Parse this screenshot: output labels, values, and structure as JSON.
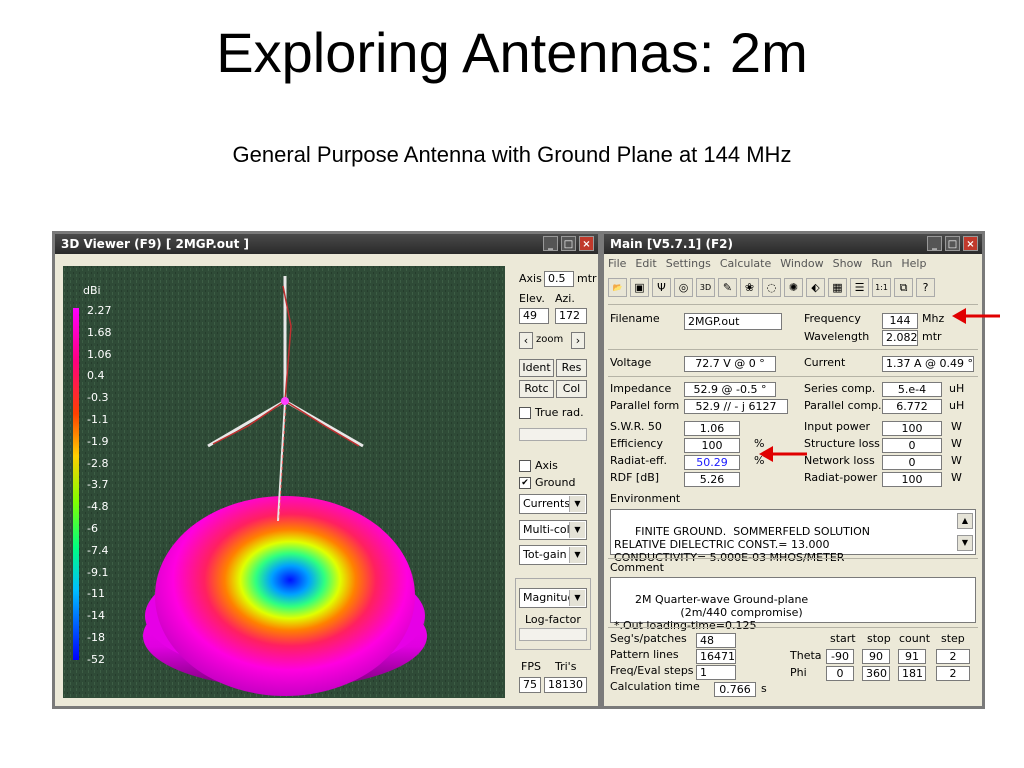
{
  "slide": {
    "title": "Exploring Antennas: 2m",
    "subtitle": "General Purpose Antenna with Ground Plane at 144 MHz"
  },
  "viewer": {
    "title": "3D Viewer (F9)    [ 2MGP.out ]",
    "legend_unit": "dBi",
    "legend": [
      "2.27",
      "1.68",
      "1.06",
      "0.4",
      "-0.3",
      "-1.1",
      "-1.9",
      "-2.8",
      "-3.7",
      "-4.8",
      "-6",
      "-7.4",
      "-9.1",
      "-11",
      "-14",
      "-18",
      "-52"
    ],
    "axis_label": "Axis",
    "axis_value": "0.5",
    "axis_unit": "mtr",
    "elev_label": "Elev.",
    "azi_label": "Azi.",
    "elev_value": "49",
    "azi_value": "172",
    "zoom_label": "zoom",
    "ident_label": "Ident",
    "res_label": "Res",
    "rotc_label": "Rotc",
    "col_label": "Col",
    "true_rad_label": "True rad.",
    "true_rad_checked": false,
    "axis_check_label": "Axis",
    "axis_checked": false,
    "ground_label": "Ground",
    "ground_checked": true,
    "currents_select": "Currents",
    "multicolor_select": "Multi-colo",
    "totgain_select": "Tot-gain",
    "magnitude_select": "Magnituc",
    "logfactor_label": "Log-factor",
    "fps_label": "FPS",
    "tris_label": "Tri's",
    "fps_value": "75",
    "tris_value": "18130"
  },
  "main": {
    "title": "Main [V5.7.1]  (F2)",
    "menu": [
      "File",
      "Edit",
      "Settings",
      "Calculate",
      "Window",
      "Show",
      "Run",
      "Help"
    ],
    "toolbar_icons": [
      "open-icon",
      "save-icon",
      "antenna-icon",
      "target-icon",
      "3d-icon",
      "edit-icon",
      "pattern-icon",
      "rings-icon",
      "radiation-icon",
      "select-icon",
      "calculator-icon",
      "list-icon",
      "ratio-icon",
      "book-icon",
      "help-icon"
    ],
    "filename_label": "Filename",
    "filename": "2MGP.out",
    "frequency_label": "Frequency",
    "frequency": "144",
    "frequency_unit": "Mhz",
    "wavelength_label": "Wavelength",
    "wavelength": "2.082",
    "wavelength_unit": "mtr",
    "voltage_label": "Voltage",
    "voltage": "72.7 V @ 0 °",
    "current_label": "Current",
    "current": "1.37 A @ 0.49 °",
    "impedance_label": "Impedance",
    "impedance": "52.9 @ -0.5 °",
    "series_comp_label": "Series comp.",
    "series_comp": "5.e-4",
    "series_comp_unit": "uH",
    "parallel_form_label": "Parallel form",
    "parallel_form": "52.9 // - j 6127",
    "parallel_comp_label": "Parallel comp.",
    "parallel_comp": "6.772",
    "parallel_comp_unit": "uH",
    "swr_label": "S.W.R. 50",
    "swr": "1.06",
    "input_power_label": "Input power",
    "input_power": "100",
    "input_power_unit": "W",
    "efficiency_label": "Efficiency",
    "efficiency": "100",
    "efficiency_unit": "%",
    "structure_loss_label": "Structure loss",
    "structure_loss": "0",
    "structure_loss_unit": "W",
    "radiat_eff_label": "Radiat-eff.",
    "radiat_eff": "50.29",
    "radiat_eff_unit": "%",
    "network_loss_label": "Network loss",
    "network_loss": "0",
    "network_loss_unit": "W",
    "rdf_label": "RDF [dB]",
    "rdf": "5.26",
    "radiat_power_label": "Radiat-power",
    "radiat_power": "100",
    "radiat_power_unit": "W",
    "environment_label": "Environment",
    "environment": "FINITE GROUND.  SOMMERFELD SOLUTION\nRELATIVE DIELECTRIC CONST.= 13.000\nCONDUCTIVITY= 5.000E-03 MHOS/METER",
    "comment_label": "Comment",
    "comment": "2M Quarter-wave Ground-plane\n                   (2m/440 compromise)\n*.Out loading-time=0.125",
    "segs_label": "Seg's/patches",
    "segs": "48",
    "pattern_lines_label": "Pattern lines",
    "pattern_lines": "16471",
    "freq_eval_label": "Freq/Eval steps",
    "freq_eval": "1",
    "calc_time_label": "Calculation time",
    "calc_time": "0.766",
    "calc_time_unit": "s",
    "col_start": "start",
    "col_stop": "stop",
    "col_count": "count",
    "col_step": "step",
    "theta_label": "Theta",
    "theta": [
      "-90",
      "90",
      "91",
      "2"
    ],
    "phi_label": "Phi",
    "phi": [
      "0",
      "360",
      "181",
      "2"
    ]
  },
  "colors": {
    "arrow": "#e00000",
    "radiat_eff_text": "#1a1aff"
  }
}
